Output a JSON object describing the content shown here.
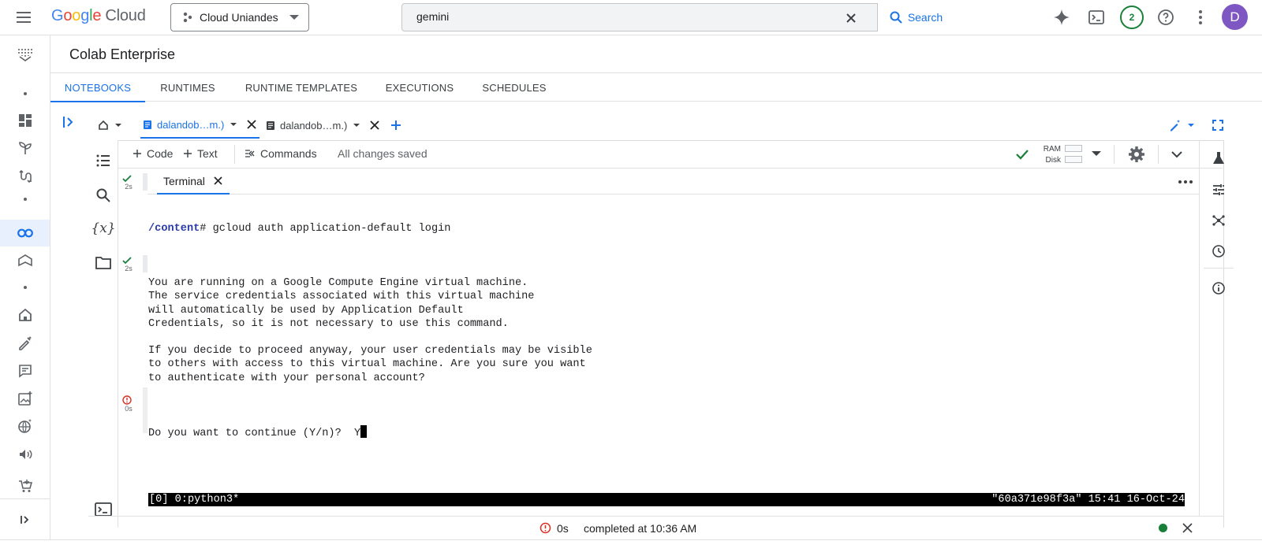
{
  "header": {
    "logo_google": "Google",
    "logo_cloud": "Cloud",
    "project": "Cloud Uniandes",
    "search": {
      "value": "gemini",
      "button_label": "Search"
    },
    "notifications_count": "2",
    "avatar_initial": "D"
  },
  "product": {
    "title": "Colab Enterprise"
  },
  "tabs": [
    {
      "label": "NOTEBOOKS",
      "active": true
    },
    {
      "label": "RUNTIMES"
    },
    {
      "label": "RUNTIME TEMPLATES"
    },
    {
      "label": "EXECUTIONS"
    },
    {
      "label": "SCHEDULES"
    }
  ],
  "notebook_tabs": [
    {
      "label": "dalandob…m.)",
      "active": true
    },
    {
      "label": "dalandob…m.)"
    }
  ],
  "toolbar": {
    "code_label": "Code",
    "text_label": "Text",
    "commands_label": "Commands",
    "save_status": "All changes saved",
    "ram_label": "RAM",
    "disk_label": "Disk"
  },
  "cells": [
    {
      "status": "ok",
      "time": "2s"
    },
    {
      "status": "ok",
      "time": "2s"
    },
    {
      "status": "error",
      "time": "0s"
    }
  ],
  "terminal": {
    "tab_label": "Terminal",
    "prompt_path": "/content",
    "prompt_command": "# gcloud auth application-default login",
    "lines": [
      "",
      "You are running on a Google Compute Engine virtual machine.",
      "The service credentials associated with this virtual machine",
      "will automatically be used by Application Default",
      "Credentials, so it is not necessary to use this command.",
      "",
      "If you decide to proceed anyway, your user credentials may be visible",
      "to others with access to this virtual machine. Are you sure you want",
      "to authenticate with your personal account?",
      ""
    ],
    "question": "Do you want to continue (Y/n)?  Y",
    "tmux_left": "[0] 0:python3*",
    "tmux_right": "\"60a371e98f3a\" 15:41 16-Oct-24"
  },
  "statusbar": {
    "exec_time": "0s",
    "completed": "completed at 10:36 AM"
  },
  "colors": {
    "accent": "#1a73e8",
    "success": "#188038",
    "error": "#d93025",
    "avatar": "#7e57c2"
  }
}
